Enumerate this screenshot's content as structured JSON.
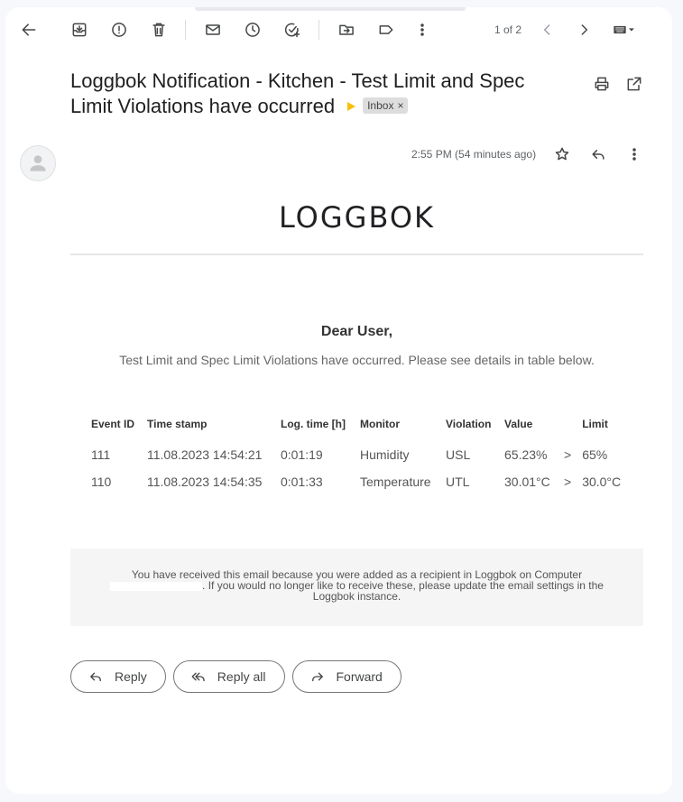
{
  "toolbar": {
    "pager_text": "1 of 2",
    "icons": [
      "back-arrow-icon",
      "archive-icon",
      "report-spam-icon",
      "delete-icon",
      "mark-unread-icon",
      "snooze-icon",
      "add-task-icon",
      "move-to-icon",
      "label-icon",
      "more-vert-icon",
      "chevron-left-icon",
      "chevron-right-icon",
      "keyboard-icon"
    ]
  },
  "email": {
    "subject": "Loggbok Notification - Kitchen - Test Limit and Spec Limit Violations have occurred",
    "label_chip": "Inbox",
    "label_chip_close": "×",
    "time": "2:55 PM (54 minutes ago)",
    "accent_color": "#f9bf0c"
  },
  "body": {
    "logo": "LOGGBOK",
    "greeting": "Dear User,",
    "intro": "Test Limit and Spec Limit Violations have occurred. Please see details in table below.",
    "table": {
      "headers": [
        "Event ID",
        "Time stamp",
        "Log. time [h]",
        "Monitor",
        "Violation",
        "Value",
        "",
        "Limit"
      ],
      "rows": [
        [
          "111",
          "11.08.2023 14:54:21",
          "0:01:19",
          "Humidity",
          "USL",
          "65.23%",
          ">",
          "65%"
        ],
        [
          "110",
          "11.08.2023 14:54:35",
          "0:01:33",
          "Temperature",
          "UTL",
          "30.01°C",
          ">",
          "30.0°C"
        ]
      ]
    },
    "footer_part1": "You have received this email because you were added as a recipient in Loggbok on Computer",
    "footer_part2": ". If you would no longer like to receive these, please update the email settings in the Loggbok instance."
  },
  "actions": {
    "reply": "Reply",
    "reply_all": "Reply all",
    "forward": "Forward"
  }
}
